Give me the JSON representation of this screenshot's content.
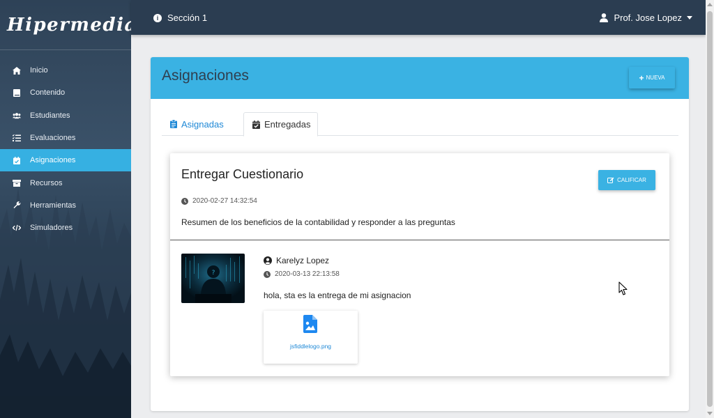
{
  "sidebar": {
    "brand": "Hipermedia",
    "items": [
      {
        "label": "Inicio",
        "icon": "home-icon"
      },
      {
        "label": "Contenido",
        "icon": "book-icon"
      },
      {
        "label": "Estudiantes",
        "icon": "users-icon"
      },
      {
        "label": "Evaluaciones",
        "icon": "tasks-icon"
      },
      {
        "label": "Asignaciones",
        "icon": "calendar-check-icon",
        "active": true
      },
      {
        "label": "Recursos",
        "icon": "archive-icon"
      },
      {
        "label": "Herramientas",
        "icon": "wrench-icon"
      },
      {
        "label": "Simuladores",
        "icon": "code-icon"
      }
    ]
  },
  "topbar": {
    "section": "Sección 1",
    "user": "Prof. Jose Lopez"
  },
  "page": {
    "title": "Asignaciones",
    "new_button": "NUEVA",
    "tabs": [
      {
        "label": "Asignadas",
        "active": false
      },
      {
        "label": "Entregadas",
        "active": true
      }
    ]
  },
  "assignment": {
    "title": "Entregar Cuestionario",
    "grade_button": "CALIFICAR",
    "date": "2020-02-27 14:32:54",
    "description": "Resumen de los beneficios de la contabilidad y responder a las preguntas"
  },
  "submission": {
    "student": "Karelyz Lopez",
    "date": "2020-03-13 22:13:58",
    "message": "hola, sta es la entrega de mi asignacion",
    "file_name": "jsfiddlelogo.png"
  },
  "colors": {
    "accent": "#3ab2e3",
    "topbar": "#2b3d51",
    "link": "#1e88d6"
  }
}
